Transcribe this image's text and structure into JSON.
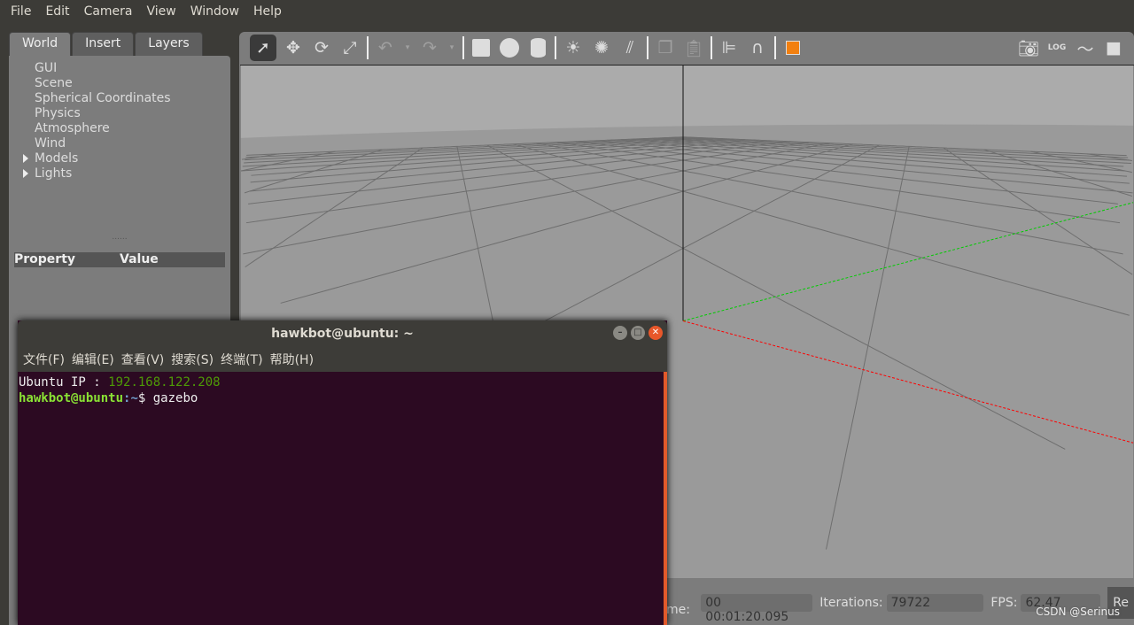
{
  "menu": [
    "File",
    "Edit",
    "Camera",
    "View",
    "Window",
    "Help"
  ],
  "left": {
    "tabs": [
      "World",
      "Insert",
      "Layers"
    ],
    "tree": [
      "GUI",
      "Scene",
      "Spherical Coordinates",
      "Physics",
      "Atmosphere",
      "Wind",
      "Models",
      "Lights"
    ],
    "property": "Property",
    "value": "Value"
  },
  "toolbar": {
    "icons": [
      "select-arrow-icon",
      "translate-icon",
      "rotate-icon",
      "scale-icon",
      "undo-icon",
      "undo-dropdown-icon",
      "redo-icon",
      "redo-dropdown-icon",
      "box-icon",
      "sphere-icon",
      "cylinder-icon",
      "point-light-icon",
      "spot-light-icon",
      "directional-light-icon",
      "copy-icon",
      "paste-icon",
      "align-icon",
      "snap-icon",
      "view-angle-icon",
      "screenshot-icon",
      "log-icon",
      "plot-icon",
      "record-video-icon"
    ]
  },
  "status": {
    "time_label": "l Time:",
    "time": "00 00:01:20.095",
    "iter_label": "Iterations:",
    "iter": "79722",
    "fps_label": "FPS:",
    "fps": "62.47",
    "reset": "Re"
  },
  "terminal": {
    "title": "hawkbot@ubuntu: ~",
    "menu": [
      "文件(F)",
      "编辑(E)",
      "查看(V)",
      "搜索(S)",
      "终端(T)",
      "帮助(H)"
    ],
    "line1_label": "Ubuntu IP : ",
    "line1_ip": "192.168.122.208",
    "prompt_user": "hawkbot@ubuntu",
    "prompt_path": ":~",
    "prompt_sym": "$ ",
    "command": "gazebo"
  },
  "watermark": "CSDN @Serinus",
  "colors": {
    "x_axis": "#ff0000",
    "y_axis": "#00cc00",
    "terminal_bg": "#2c0a22"
  }
}
